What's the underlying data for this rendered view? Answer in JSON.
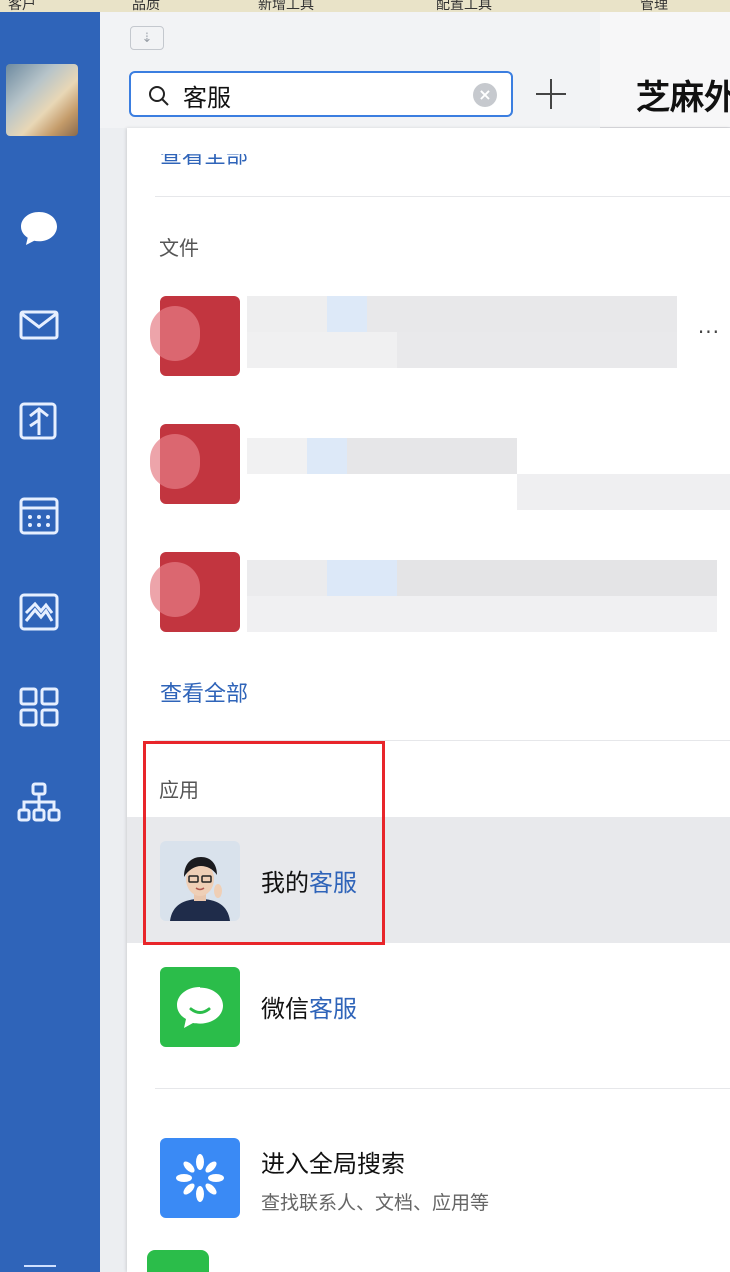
{
  "top_strip": [
    "客户",
    "品质",
    "新增工具",
    "配置工具",
    "管理"
  ],
  "search": {
    "value": "客服",
    "clear_label": "×"
  },
  "chat": {
    "title": "芝麻外"
  },
  "panel": {
    "files_section": {
      "title": "文件",
      "view_all": "查看全部",
      "items": [
        {
          "more": "..."
        },
        {},
        {}
      ]
    },
    "apps_section": {
      "title": "应用",
      "items": [
        {
          "name_prefix": "我的",
          "name_highlight": "客服"
        },
        {
          "name_prefix": "微信",
          "name_highlight": "客服"
        }
      ]
    },
    "global_search": {
      "title": "进入全局搜索",
      "subtitle": "查找联系人、文档、应用等"
    }
  },
  "colors": {
    "nav_bg": "#2f64b9",
    "accent": "#3b7ee0",
    "highlight": "#2f64b9",
    "annotation": "#e8252a",
    "wechat_green": "#2bbd4a",
    "file_red": "#c2353f"
  },
  "icons": {
    "nav": [
      "chat-icon",
      "mail-icon",
      "doc-icon",
      "calendar-icon",
      "drive-icon",
      "workbench-icon",
      "org-chart-icon"
    ]
  }
}
